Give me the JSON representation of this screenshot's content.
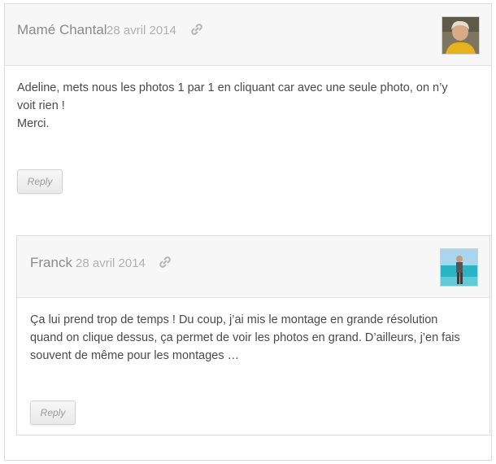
{
  "comments": [
    {
      "author": "Mamé Chantal",
      "date": "28 avril 2014",
      "body_lines": [
        "Adeline, mets nous les photos 1 par 1 en cliquant car avec une seule photo, on n’y",
        "voit rien !",
        "Merci."
      ],
      "reply_label": "Reply",
      "avatar_colors": {
        "bg": "#8a7a5c",
        "accent": "#e8b020",
        "face": "#d9b08c"
      }
    },
    {
      "author": "Franck",
      "date": "28 avril 2014",
      "body_lines": [
        "Ça lui prend trop de temps ! Du coup, j’ai mis le montage en grande résolution",
        "quand on clique dessus, ça permet de voir les photos en grand. D’ailleurs, j’en fais",
        "souvent de même pour les montages …"
      ],
      "reply_label": "Reply",
      "avatar_colors": {
        "sky": "#9fd0ea",
        "sea": "#2bb6c8",
        "figure": "#4a4a4a"
      }
    }
  ],
  "icons": {
    "permalink": "link-chain-icon"
  }
}
